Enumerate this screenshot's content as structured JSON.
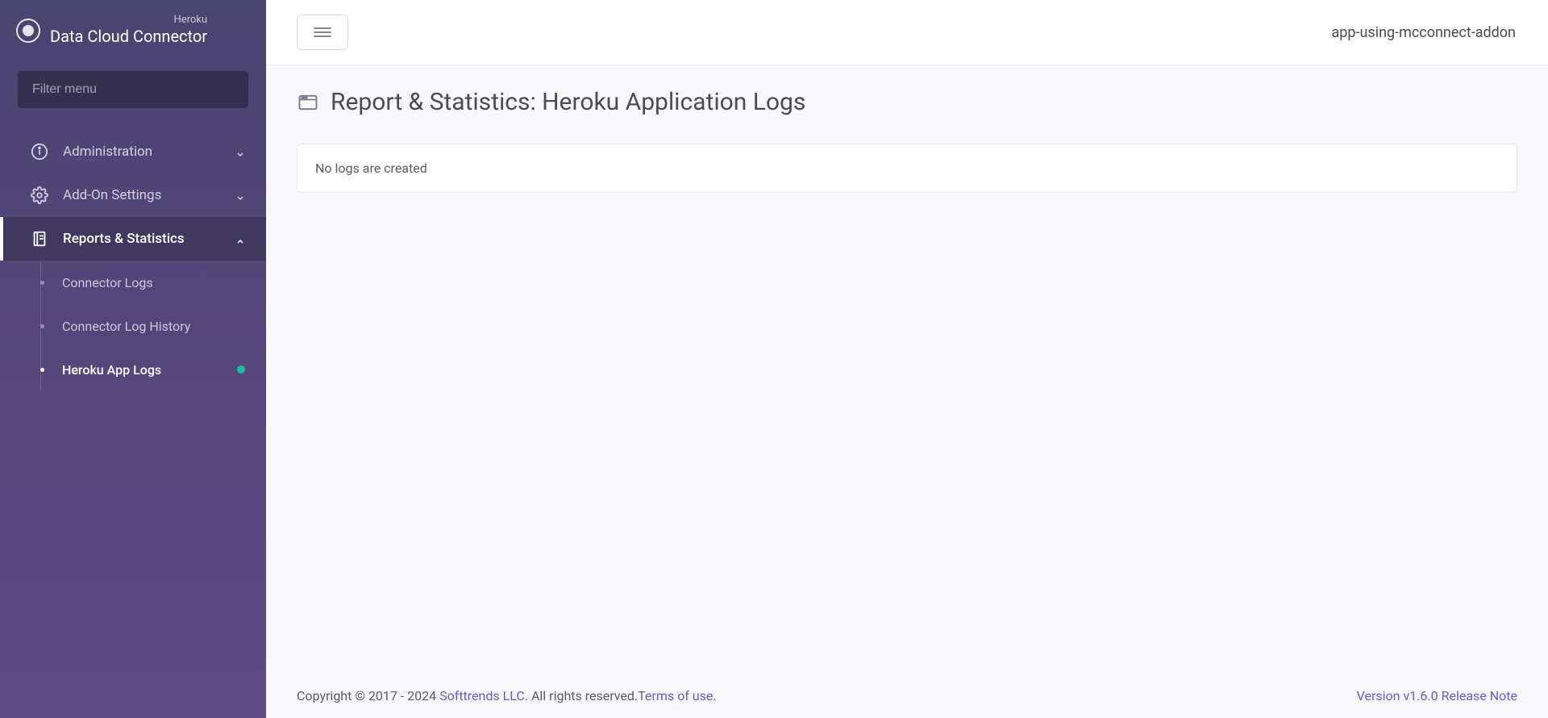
{
  "brand": {
    "heroku": "Heroku",
    "title": "Data Cloud Connector"
  },
  "sidebar": {
    "filter_placeholder": "Filter menu",
    "items": [
      {
        "icon": "info-icon",
        "label": "Administration",
        "expanded": false,
        "active": false
      },
      {
        "icon": "gear-icon",
        "label": "Add-On Settings",
        "expanded": false,
        "active": false
      },
      {
        "icon": "book-icon",
        "label": "Reports & Statistics",
        "expanded": true,
        "active": true
      }
    ],
    "submenu": [
      {
        "label": "Connector Logs",
        "selected": false,
        "indicator": false
      },
      {
        "label": "Connector Log History",
        "selected": false,
        "indicator": false
      },
      {
        "label": "Heroku App Logs",
        "selected": true,
        "indicator": true
      }
    ]
  },
  "topbar": {
    "app_name": "app-using-mcconnect-addon"
  },
  "page": {
    "title": "Report & Statistics: Heroku Application Logs",
    "empty_message": "No logs are created"
  },
  "footer": {
    "copyright_prefix": "Copyright © 2017 - 2024 ",
    "company": "Softtrends LLC",
    "rights": ". All rights reserved.",
    "terms": "Terms of use",
    "dot": ".",
    "version": "Version v1.6.0 ",
    "release_note": " Release Note"
  }
}
